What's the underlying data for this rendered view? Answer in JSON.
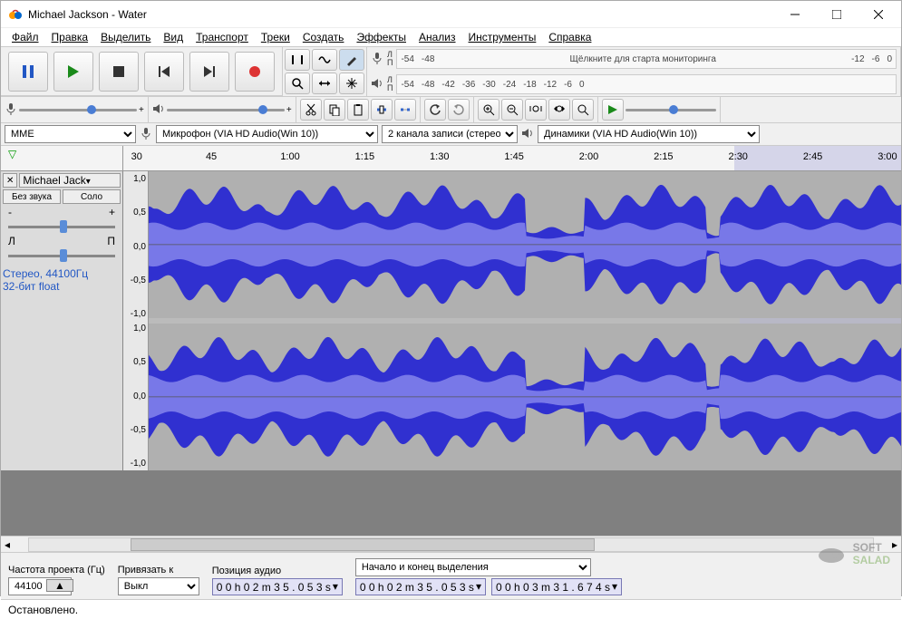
{
  "window": {
    "title": "Michael Jackson - Water"
  },
  "menu": [
    "Файл",
    "Правка",
    "Выделить",
    "Вид",
    "Транспорт",
    "Треки",
    "Создать",
    "Эффекты",
    "Анализ",
    "Инструменты",
    "Справка"
  ],
  "meter": {
    "rec_ticks": [
      "-54",
      "-48"
    ],
    "rec_hint": "Щёлкните для старта мониторинга",
    "rec_ticks2": [
      "-12",
      "-6",
      "0"
    ],
    "play_ticks": [
      "-54",
      "-48",
      "-42",
      "-36",
      "-30",
      "-24",
      "-18",
      "-12",
      "-6",
      "0"
    ]
  },
  "device": {
    "host": "MME",
    "input": "Микрофон (VIA HD Audio(Win 10))",
    "channels": "2 канала записи (стерео)",
    "output": "Динамики (VIA HD Audio(Win 10))"
  },
  "ruler": [
    "30",
    "45",
    "1:00",
    "1:15",
    "1:30",
    "1:45",
    "2:00",
    "2:15",
    "2:30",
    "2:45",
    "3:00"
  ],
  "track": {
    "name": "Michael Jack",
    "mute": "Без звука",
    "solo": "Соло",
    "format1": "Стерео, 44100Гц",
    "format2": "32-бит float",
    "vscale": [
      "1,0",
      "0,5",
      "0,0",
      "-0,5",
      "-1,0"
    ]
  },
  "selection": {
    "rate_label": "Частота проекта (Гц)",
    "rate": "44100",
    "snap_label": "Привязать к",
    "snap": "Выкл",
    "pos_label": "Позиция аудио",
    "pos": "0 0 h 0 2 m 3 5 . 0 5 3 s",
    "range_label": "Начало и конец выделения",
    "start": "0 0 h 0 2 m 3 5 . 0 5 3 s",
    "end": "0 0 h 0 3 m 3 1 . 6 7 4 s"
  },
  "status": "Остановлено.",
  "watermark": "SOFT SALAD"
}
